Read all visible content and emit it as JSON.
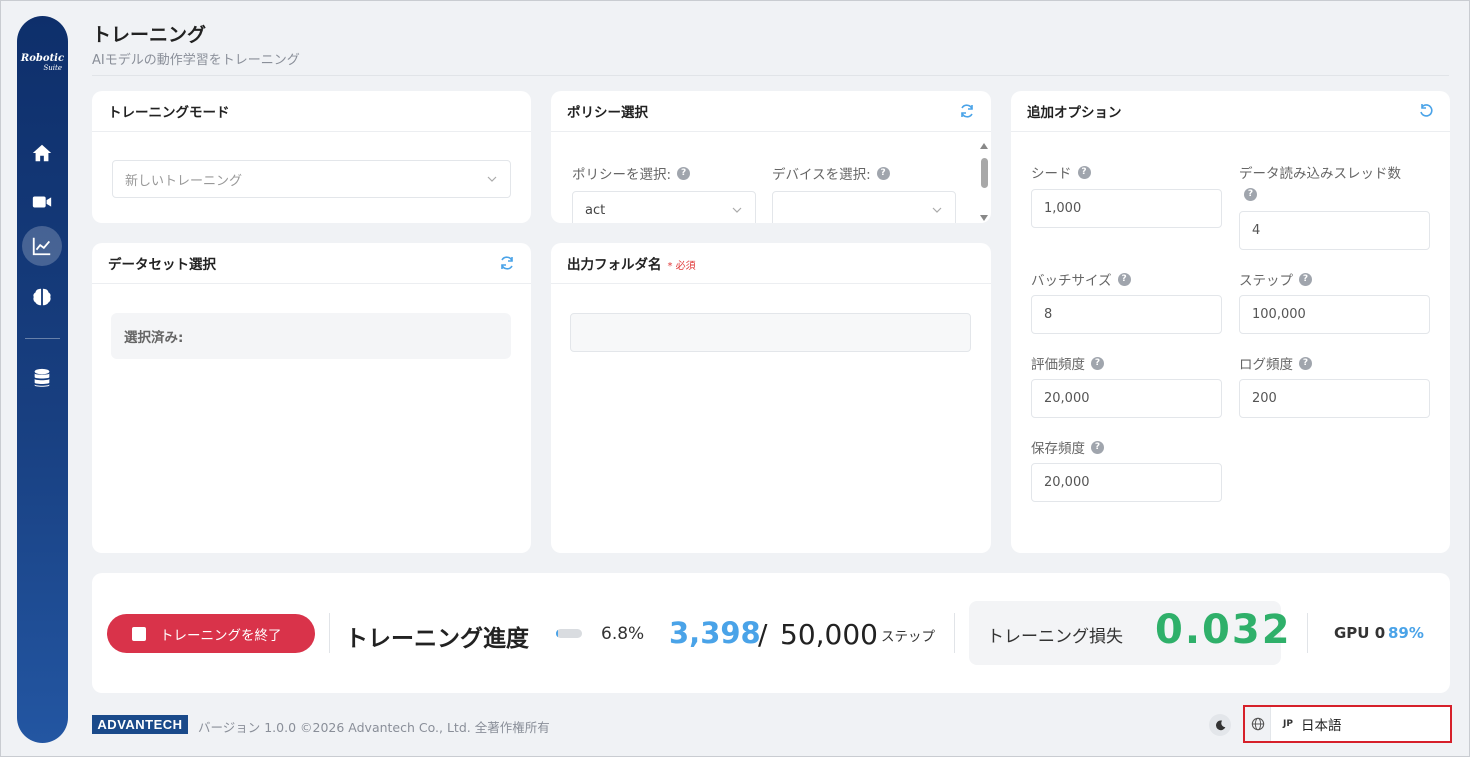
{
  "sidebar": {
    "logo": {
      "line1": "Robotic",
      "line2": "Suite"
    },
    "items": [
      {
        "name": "home",
        "icon": "home-icon"
      },
      {
        "name": "camera",
        "icon": "video-camera-icon"
      },
      {
        "name": "training",
        "icon": "chart-line-icon",
        "active": true
      },
      {
        "name": "inference",
        "icon": "brain-icon"
      },
      {
        "name": "data",
        "icon": "database-icon"
      }
    ]
  },
  "header": {
    "title": "トレーニング",
    "subtitle": "AIモデルの動作学習をトレーニング"
  },
  "training_mode": {
    "title": "トレーニングモード",
    "select_placeholder": "新しいトレーニング"
  },
  "policy": {
    "title": "ポリシー選択",
    "policy_label": "ポリシーを選択:",
    "policy_value": "act",
    "device_label": "デバイスを選択:",
    "device_value": ""
  },
  "dataset": {
    "title": "データセット選択",
    "selected_label": "選択済み:"
  },
  "output": {
    "title": "出力フォルダ名",
    "required": "* 必須",
    "value": ""
  },
  "options": {
    "title": "追加オプション",
    "fields": {
      "seed": {
        "label": "シード",
        "value": "1,000"
      },
      "workers": {
        "label": "データ読み込みスレッド数",
        "value": "4"
      },
      "batch": {
        "label": "バッチサイズ",
        "value": "8"
      },
      "steps": {
        "label": "ステップ",
        "value": "100,000"
      },
      "eval_freq": {
        "label": "評価頻度",
        "value": "20,000"
      },
      "log_freq": {
        "label": "ログ頻度",
        "value": "200"
      },
      "save_freq": {
        "label": "保存頻度",
        "value": "20,000"
      }
    }
  },
  "progress": {
    "stop_label": "トレーニングを終了",
    "title": "トレーニング進度",
    "percent_text": "6.8%",
    "fraction": 0.068,
    "current_step": "3,398",
    "separator": "/",
    "total_steps": "50,000",
    "unit": "ステップ",
    "loss_label": "トレーニング損失",
    "loss_value": "0.032",
    "gpu_label": "GPU 0",
    "gpu_value": "89%"
  },
  "footer": {
    "brand": "ADVANTECH",
    "text": "バージョン 1.0.0 ©2026 Advantech Co., Ltd. 全著作権所有",
    "lang_code": "JP",
    "lang_name": "日本語"
  },
  "colors": {
    "accent": "#4aa3e8",
    "danger": "#d9334a",
    "success": "#2fb06a",
    "sidebar": "#183f80"
  }
}
